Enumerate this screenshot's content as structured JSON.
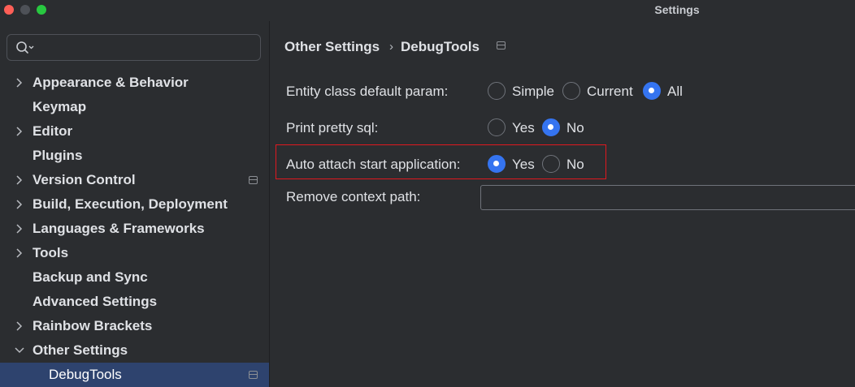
{
  "window": {
    "title": "Settings"
  },
  "search": {
    "placeholder": ""
  },
  "sidebar": {
    "items": [
      {
        "label": "Appearance & Behavior",
        "expandable": true,
        "expanded": false,
        "pinned": false
      },
      {
        "label": "Keymap",
        "expandable": false,
        "pinned": false
      },
      {
        "label": "Editor",
        "expandable": true,
        "expanded": false,
        "pinned": false
      },
      {
        "label": "Plugins",
        "expandable": false,
        "pinned": false
      },
      {
        "label": "Version Control",
        "expandable": true,
        "expanded": false,
        "pinned": true
      },
      {
        "label": "Build, Execution, Deployment",
        "expandable": true,
        "expanded": false,
        "pinned": false
      },
      {
        "label": "Languages & Frameworks",
        "expandable": true,
        "expanded": false,
        "pinned": false
      },
      {
        "label": "Tools",
        "expandable": true,
        "expanded": false,
        "pinned": false
      },
      {
        "label": "Backup and Sync",
        "expandable": false,
        "pinned": false
      },
      {
        "label": "Advanced Settings",
        "expandable": false,
        "pinned": false
      },
      {
        "label": "Rainbow Brackets",
        "expandable": true,
        "expanded": false,
        "pinned": false
      },
      {
        "label": "Other Settings",
        "expandable": true,
        "expanded": true,
        "pinned": false
      },
      {
        "label": "DebugTools",
        "expandable": false,
        "child": true,
        "selected": true,
        "pinned": true
      }
    ]
  },
  "breadcrumb": {
    "parent": "Other Settings",
    "separator": "›",
    "current": "DebugTools"
  },
  "settings": {
    "entity_param": {
      "label": "Entity class default param:",
      "options": [
        {
          "label": "Simple",
          "selected": false
        },
        {
          "label": "Current",
          "selected": false
        },
        {
          "label": "All",
          "selected": true
        }
      ]
    },
    "print_sql": {
      "label": "Print pretty sql:",
      "options": [
        {
          "label": "Yes",
          "selected": false
        },
        {
          "label": "No",
          "selected": true
        }
      ]
    },
    "auto_attach": {
      "label": "Auto attach start application:",
      "options": [
        {
          "label": "Yes",
          "selected": true
        },
        {
          "label": "No",
          "selected": false
        }
      ]
    },
    "context_path": {
      "label": "Remove context path:",
      "value": ""
    }
  },
  "colors": {
    "background": "#2b2d30",
    "selection": "#2e436e",
    "accent": "#3574f0",
    "highlight_border": "#e0181f",
    "text": "#dfe1e5"
  },
  "icons": {
    "search": "search-icon",
    "expand": "chevron-right-icon",
    "collapse": "chevron-down-icon",
    "pin": "pin-window-icon"
  }
}
